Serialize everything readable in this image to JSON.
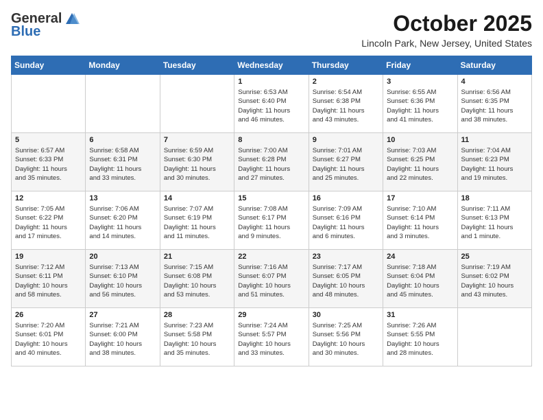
{
  "header": {
    "logo_general": "General",
    "logo_blue": "Blue",
    "month_title": "October 2025",
    "location": "Lincoln Park, New Jersey, United States"
  },
  "days_of_week": [
    "Sunday",
    "Monday",
    "Tuesday",
    "Wednesday",
    "Thursday",
    "Friday",
    "Saturday"
  ],
  "weeks": [
    [
      {
        "day": "",
        "info": ""
      },
      {
        "day": "",
        "info": ""
      },
      {
        "day": "",
        "info": ""
      },
      {
        "day": "1",
        "info": "Sunrise: 6:53 AM\nSunset: 6:40 PM\nDaylight: 11 hours\nand 46 minutes."
      },
      {
        "day": "2",
        "info": "Sunrise: 6:54 AM\nSunset: 6:38 PM\nDaylight: 11 hours\nand 43 minutes."
      },
      {
        "day": "3",
        "info": "Sunrise: 6:55 AM\nSunset: 6:36 PM\nDaylight: 11 hours\nand 41 minutes."
      },
      {
        "day": "4",
        "info": "Sunrise: 6:56 AM\nSunset: 6:35 PM\nDaylight: 11 hours\nand 38 minutes."
      }
    ],
    [
      {
        "day": "5",
        "info": "Sunrise: 6:57 AM\nSunset: 6:33 PM\nDaylight: 11 hours\nand 35 minutes."
      },
      {
        "day": "6",
        "info": "Sunrise: 6:58 AM\nSunset: 6:31 PM\nDaylight: 11 hours\nand 33 minutes."
      },
      {
        "day": "7",
        "info": "Sunrise: 6:59 AM\nSunset: 6:30 PM\nDaylight: 11 hours\nand 30 minutes."
      },
      {
        "day": "8",
        "info": "Sunrise: 7:00 AM\nSunset: 6:28 PM\nDaylight: 11 hours\nand 27 minutes."
      },
      {
        "day": "9",
        "info": "Sunrise: 7:01 AM\nSunset: 6:27 PM\nDaylight: 11 hours\nand 25 minutes."
      },
      {
        "day": "10",
        "info": "Sunrise: 7:03 AM\nSunset: 6:25 PM\nDaylight: 11 hours\nand 22 minutes."
      },
      {
        "day": "11",
        "info": "Sunrise: 7:04 AM\nSunset: 6:23 PM\nDaylight: 11 hours\nand 19 minutes."
      }
    ],
    [
      {
        "day": "12",
        "info": "Sunrise: 7:05 AM\nSunset: 6:22 PM\nDaylight: 11 hours\nand 17 minutes."
      },
      {
        "day": "13",
        "info": "Sunrise: 7:06 AM\nSunset: 6:20 PM\nDaylight: 11 hours\nand 14 minutes."
      },
      {
        "day": "14",
        "info": "Sunrise: 7:07 AM\nSunset: 6:19 PM\nDaylight: 11 hours\nand 11 minutes."
      },
      {
        "day": "15",
        "info": "Sunrise: 7:08 AM\nSunset: 6:17 PM\nDaylight: 11 hours\nand 9 minutes."
      },
      {
        "day": "16",
        "info": "Sunrise: 7:09 AM\nSunset: 6:16 PM\nDaylight: 11 hours\nand 6 minutes."
      },
      {
        "day": "17",
        "info": "Sunrise: 7:10 AM\nSunset: 6:14 PM\nDaylight: 11 hours\nand 3 minutes."
      },
      {
        "day": "18",
        "info": "Sunrise: 7:11 AM\nSunset: 6:13 PM\nDaylight: 11 hours\nand 1 minute."
      }
    ],
    [
      {
        "day": "19",
        "info": "Sunrise: 7:12 AM\nSunset: 6:11 PM\nDaylight: 10 hours\nand 58 minutes."
      },
      {
        "day": "20",
        "info": "Sunrise: 7:13 AM\nSunset: 6:10 PM\nDaylight: 10 hours\nand 56 minutes."
      },
      {
        "day": "21",
        "info": "Sunrise: 7:15 AM\nSunset: 6:08 PM\nDaylight: 10 hours\nand 53 minutes."
      },
      {
        "day": "22",
        "info": "Sunrise: 7:16 AM\nSunset: 6:07 PM\nDaylight: 10 hours\nand 51 minutes."
      },
      {
        "day": "23",
        "info": "Sunrise: 7:17 AM\nSunset: 6:05 PM\nDaylight: 10 hours\nand 48 minutes."
      },
      {
        "day": "24",
        "info": "Sunrise: 7:18 AM\nSunset: 6:04 PM\nDaylight: 10 hours\nand 45 minutes."
      },
      {
        "day": "25",
        "info": "Sunrise: 7:19 AM\nSunset: 6:02 PM\nDaylight: 10 hours\nand 43 minutes."
      }
    ],
    [
      {
        "day": "26",
        "info": "Sunrise: 7:20 AM\nSunset: 6:01 PM\nDaylight: 10 hours\nand 40 minutes."
      },
      {
        "day": "27",
        "info": "Sunrise: 7:21 AM\nSunset: 6:00 PM\nDaylight: 10 hours\nand 38 minutes."
      },
      {
        "day": "28",
        "info": "Sunrise: 7:23 AM\nSunset: 5:58 PM\nDaylight: 10 hours\nand 35 minutes."
      },
      {
        "day": "29",
        "info": "Sunrise: 7:24 AM\nSunset: 5:57 PM\nDaylight: 10 hours\nand 33 minutes."
      },
      {
        "day": "30",
        "info": "Sunrise: 7:25 AM\nSunset: 5:56 PM\nDaylight: 10 hours\nand 30 minutes."
      },
      {
        "day": "31",
        "info": "Sunrise: 7:26 AM\nSunset: 5:55 PM\nDaylight: 10 hours\nand 28 minutes."
      },
      {
        "day": "",
        "info": ""
      }
    ]
  ]
}
